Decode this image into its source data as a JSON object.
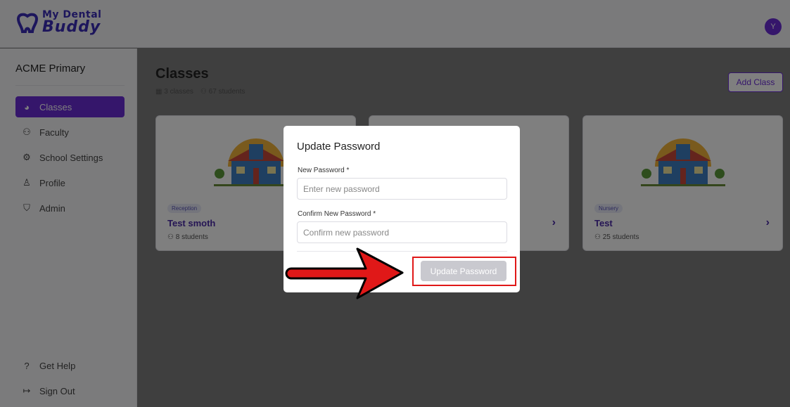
{
  "app": {
    "logo_line1": "My Dental",
    "logo_line2": "Buddy",
    "avatar_initial": "Y"
  },
  "sidebar": {
    "school_name": "ACME Primary",
    "items": [
      {
        "label": "Classes",
        "icon": "pie-icon",
        "active": true
      },
      {
        "label": "Faculty",
        "icon": "people-icon"
      },
      {
        "label": "School Settings",
        "icon": "gear-icon"
      },
      {
        "label": "Profile",
        "icon": "user-icon"
      },
      {
        "label": "Admin",
        "icon": "shield-icon"
      }
    ],
    "bottom_items": [
      {
        "label": "Get Help",
        "icon": "help-icon"
      },
      {
        "label": "Sign Out",
        "icon": "sign-out-icon"
      }
    ]
  },
  "main": {
    "title": "Classes",
    "classes_count": "3 classes",
    "students_count": "67 students",
    "add_class_label": "Add Class",
    "cards": [
      {
        "tag": "Reception",
        "title": "Test smoth",
        "students": "8 students"
      },
      {
        "tag": "",
        "title": "",
        "students": ""
      },
      {
        "tag": "Nursery",
        "title": "Test",
        "students": "25 students"
      }
    ]
  },
  "modal": {
    "title": "Update Password",
    "new_password_label": "New Password *",
    "new_password_placeholder": "Enter new password",
    "confirm_password_label": "Confirm New Password *",
    "confirm_password_placeholder": "Confirm new password",
    "submit_label": "Update Password"
  },
  "colors": {
    "accent": "#6a2cd6",
    "highlight": "#e01818"
  }
}
